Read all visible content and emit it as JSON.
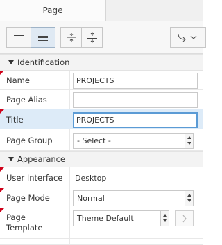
{
  "tabs": [
    {
      "label": "Page"
    }
  ],
  "sections": {
    "identification": "Identification",
    "appearance": "Appearance"
  },
  "identification": {
    "name": {
      "label": "Name",
      "value": "PROJECTS"
    },
    "page_alias": {
      "label": "Page Alias",
      "value": ""
    },
    "title": {
      "label": "Title",
      "value": "PROJECTS"
    },
    "page_group": {
      "label": "Page Group",
      "value": "- Select -"
    }
  },
  "appearance": {
    "user_interface": {
      "label": "User Interface",
      "value": "Desktop"
    },
    "page_mode": {
      "label": "Page Mode",
      "value": "Normal"
    },
    "page_template": {
      "label": "Page\nTemplate",
      "value": "Theme Default"
    }
  },
  "colors": {
    "selected_row": "#ddebf8",
    "required_marker": "#d0021b",
    "active_toggle": "#dfe9f3",
    "focus_border": "#5b9bd5"
  },
  "icons": {
    "toolbar": [
      "normal-density-icon",
      "compact-density-icon",
      "collapse-all-icon",
      "expand-all-icon",
      "go-to-menu-icon"
    ]
  }
}
